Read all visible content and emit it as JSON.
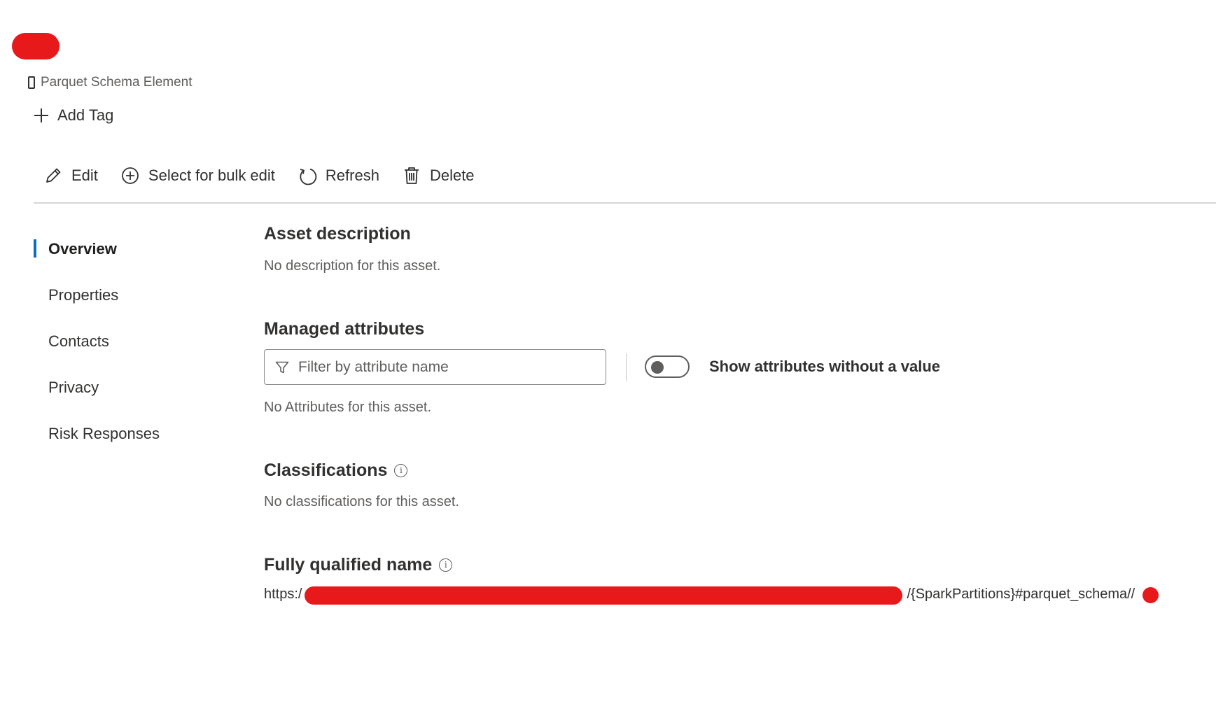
{
  "header": {
    "asset_type": "Parquet Schema Element",
    "add_tag_label": "Add Tag"
  },
  "toolbar": {
    "edit_label": "Edit",
    "bulk_edit_label": "Select for bulk edit",
    "refresh_label": "Refresh",
    "delete_label": "Delete"
  },
  "nav": {
    "items": [
      {
        "label": "Overview",
        "active": true
      },
      {
        "label": "Properties"
      },
      {
        "label": "Contacts"
      },
      {
        "label": "Privacy"
      },
      {
        "label": "Risk Responses"
      }
    ]
  },
  "overview": {
    "asset_description": {
      "title": "Asset description",
      "empty_text": "No description for this asset."
    },
    "managed_attributes": {
      "title": "Managed attributes",
      "filter_placeholder": "Filter by attribute name",
      "toggle_label": "Show attributes without a value",
      "toggle_on": false,
      "empty_text": "No Attributes for this asset."
    },
    "classifications": {
      "title": "Classifications",
      "empty_text": "No classifications for this asset."
    },
    "fully_qualified_name": {
      "title": "Fully qualified name",
      "prefix": "https:/",
      "suffix": "/{SparkPartitions}#parquet_schema//"
    }
  },
  "colors": {
    "accent": "#0f6cbd",
    "redaction": "#e8191b"
  }
}
